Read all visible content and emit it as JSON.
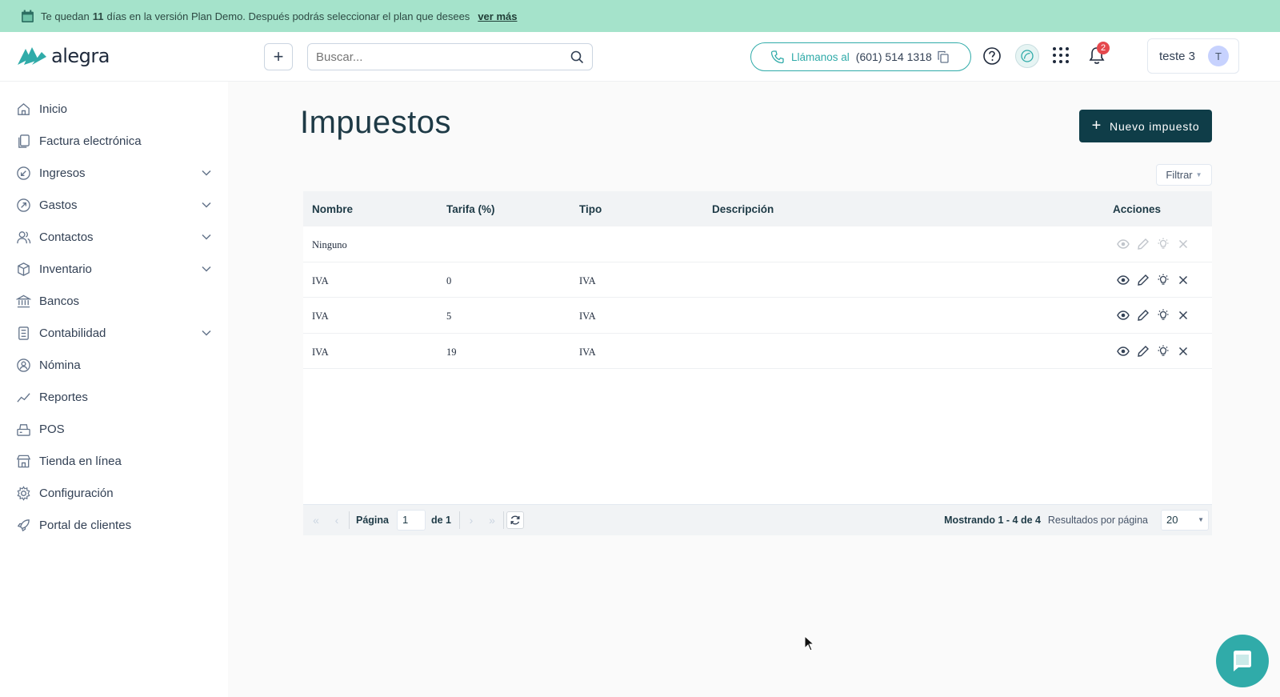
{
  "banner": {
    "prefix": "Te quedan",
    "days": "11",
    "suffix": "días en la versión Plan Demo. Después podrás seleccionar el plan que desees",
    "link": "ver más",
    "icon": "calendar-icon"
  },
  "header": {
    "logo": "alegra",
    "add_label": "+",
    "search_placeholder": "Buscar...",
    "call_label": "Llámanos al",
    "call_number": "(601) 514 1318",
    "notifications_count": "2",
    "user_name": "teste 3",
    "user_initial": "T",
    "brand_color": "#30aba9"
  },
  "sidebar": {
    "items": [
      {
        "label": "Inicio",
        "icon": "home-icon"
      },
      {
        "label": "Factura electrónica",
        "icon": "document-icon"
      },
      {
        "label": "Ingresos",
        "icon": "income-icon",
        "expandable": true
      },
      {
        "label": "Gastos",
        "icon": "expense-icon",
        "expandable": true
      },
      {
        "label": "Contactos",
        "icon": "contacts-icon",
        "expandable": true
      },
      {
        "label": "Inventario",
        "icon": "box-icon",
        "expandable": true
      },
      {
        "label": "Bancos",
        "icon": "bank-icon"
      },
      {
        "label": "Contabilidad",
        "icon": "calculator-icon",
        "expandable": true
      },
      {
        "label": "Nómina",
        "icon": "payroll-icon"
      },
      {
        "label": "Reportes",
        "icon": "chart-icon"
      },
      {
        "label": "POS",
        "icon": "pos-icon"
      },
      {
        "label": "Tienda en línea",
        "icon": "store-icon"
      },
      {
        "label": "Configuración",
        "icon": "gear-icon"
      },
      {
        "label": "Portal de clientes",
        "icon": "rocket-icon"
      }
    ]
  },
  "main": {
    "title": "Impuestos",
    "new_button": "Nuevo impuesto",
    "filter_button": "Filtrar",
    "table": {
      "columns": [
        "Nombre",
        "Tarifa (%)",
        "Tipo",
        "Descripción",
        "Acciones"
      ],
      "rows": [
        {
          "nombre": "Ninguno",
          "tarifa": "",
          "tipo": "",
          "descripcion": "",
          "actions_enabled": false
        },
        {
          "nombre": "IVA",
          "tarifa": "0",
          "tipo": "IVA",
          "descripcion": "",
          "actions_enabled": true
        },
        {
          "nombre": "IVA",
          "tarifa": "5",
          "tipo": "IVA",
          "descripcion": "",
          "actions_enabled": true
        },
        {
          "nombre": "IVA",
          "tarifa": "19",
          "tipo": "IVA",
          "descripcion": "",
          "actions_enabled": true
        }
      ]
    },
    "pager": {
      "page_label": "Página",
      "page_value": "1",
      "of_label": "de 1",
      "showing": "Mostrando 1 - 4 de 4",
      "per_page_label": "Resultados por página",
      "per_page_value": "20"
    }
  }
}
